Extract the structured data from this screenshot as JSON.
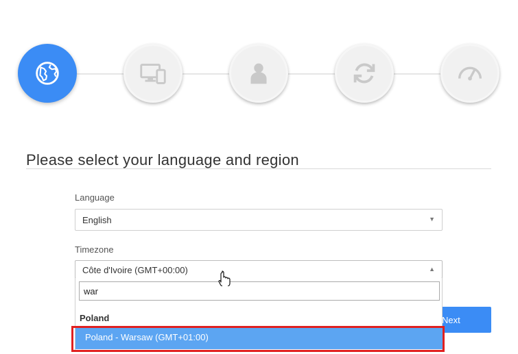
{
  "wizard": {
    "steps": [
      {
        "icon": "globe-icon",
        "active": true
      },
      {
        "icon": "devices-icon",
        "active": false
      },
      {
        "icon": "user-icon",
        "active": false
      },
      {
        "icon": "sync-icon",
        "active": false
      },
      {
        "icon": "speedometer-icon",
        "active": false
      }
    ]
  },
  "page": {
    "title": "Please select your language and region"
  },
  "language": {
    "label": "Language",
    "value": "English"
  },
  "timezone": {
    "label": "Timezone",
    "value": "Côte d'Ivoire (GMT+00:00)",
    "search_value": "war",
    "group_label": "Poland",
    "highlighted_option": "Poland - Warsaw (GMT+01:00)"
  },
  "actions": {
    "next_label": "Next"
  },
  "colors": {
    "accent": "#3b8cf5",
    "highlight": "#5ca5f2",
    "annotation_red": "#e02020"
  }
}
